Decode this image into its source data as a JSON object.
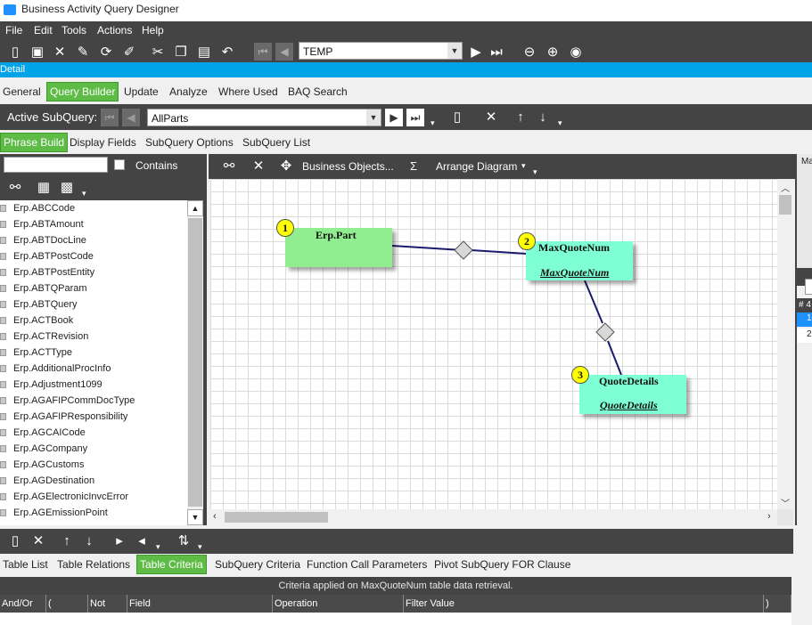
{
  "window": {
    "title": "Business Activity Query Designer"
  },
  "menu": [
    "File",
    "Edit",
    "Tools",
    "Actions",
    "Help"
  ],
  "toolbar": {
    "query_name": "TEMP"
  },
  "section_bar": {
    "label": "Detail"
  },
  "main_tabs": [
    "General",
    "Query Builder",
    "Update",
    "Analyze",
    "Where Used",
    "BAQ Search"
  ],
  "subquery_bar": {
    "label": "Active SubQuery:",
    "value": "AllParts"
  },
  "sub_tabs": [
    "Phrase Build",
    "Display Fields",
    "SubQuery Options",
    "SubQuery List"
  ],
  "search": {
    "value": "",
    "contains_label": "Contains"
  },
  "table_list": [
    "Erp.ABCCode",
    "Erp.ABTAmount",
    "Erp.ABTDocLine",
    "Erp.ABTPostCode",
    "Erp.ABTPostEntity",
    "Erp.ABTQParam",
    "Erp.ABTQuery",
    "Erp.ACTBook",
    "Erp.ACTRevision",
    "Erp.ACTType",
    "Erp.AdditionalProcInfo",
    "Erp.Adjustment1099",
    "Erp.AGAFIPCommDocType",
    "Erp.AGAFIPResponsibility",
    "Erp.AGCAICode",
    "Erp.AGCompany",
    "Erp.AGCustoms",
    "Erp.AGDestination",
    "Erp.AGElectronicInvcError",
    "Erp.AGEmissionPoint"
  ],
  "diagram_toolbar": {
    "business_objects": "Business Objects...",
    "sigma": "Σ",
    "arrange": "Arrange Diagram"
  },
  "diagram": {
    "nodes": [
      {
        "badge": "1",
        "title": "Erp.Part",
        "subtitle": "",
        "color": "#90ee90"
      },
      {
        "badge": "2",
        "title": "MaxQuoteNum",
        "subtitle": "MaxQuoteNum",
        "color": "#7fffd4"
      },
      {
        "badge": "3",
        "title": "QuoteDetails",
        "subtitle": "QuoteDetails",
        "color": "#7fffd4"
      }
    ]
  },
  "right_panel": {
    "label": "Ma",
    "row_header": "# 4",
    "row1": "1",
    "row2": "2"
  },
  "bottom_tabs": [
    "Table List",
    "Table Relations",
    "Table Criteria",
    "SubQuery Criteria",
    "Function Call Parameters",
    "Pivot SubQuery FOR Clause"
  ],
  "criteria": {
    "caption": "Criteria applied on MaxQuoteNum table data retrieval.",
    "columns": [
      "And/Or",
      "(",
      "Not",
      "Field",
      "Operation",
      "Filter Value",
      ")"
    ]
  },
  "colors": {
    "accent_blue": "#00a2e8",
    "toolbar_dark": "#444444",
    "active_tab": "#5dbb46"
  }
}
